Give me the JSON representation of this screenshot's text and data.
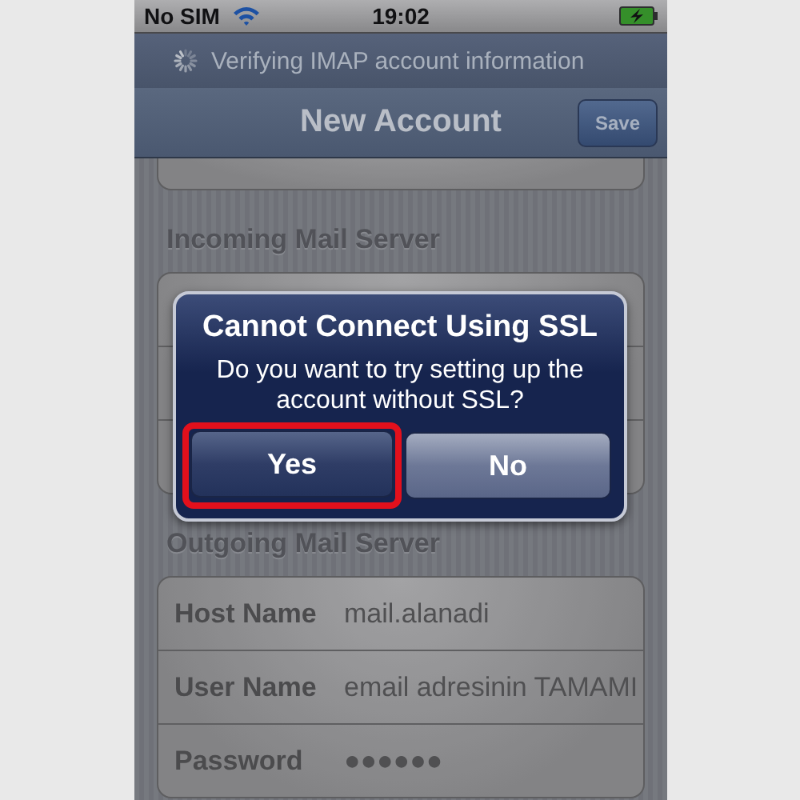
{
  "status_bar": {
    "carrier": "No SIM",
    "time": "19:02"
  },
  "activity": {
    "text": "Verifying IMAP account information"
  },
  "nav_bar": {
    "title": "New Account",
    "save_button": "Save"
  },
  "sections": [
    {
      "header": "Incoming Mail Server"
    },
    {
      "header": "Outgoing Mail Server",
      "rows": [
        {
          "label": "Host Name",
          "value": "mail.alanadi"
        },
        {
          "label": "User Name",
          "value": "email adresinin TAMAMI"
        },
        {
          "label": "Password",
          "value": "●●●●●●"
        }
      ]
    }
  ],
  "alert": {
    "title": "Cannot Connect Using SSL",
    "message": "Do you want to try setting up the account without SSL?",
    "buttons": [
      {
        "label": "Yes",
        "highlighted": true
      },
      {
        "label": "No",
        "highlighted": false
      }
    ]
  }
}
